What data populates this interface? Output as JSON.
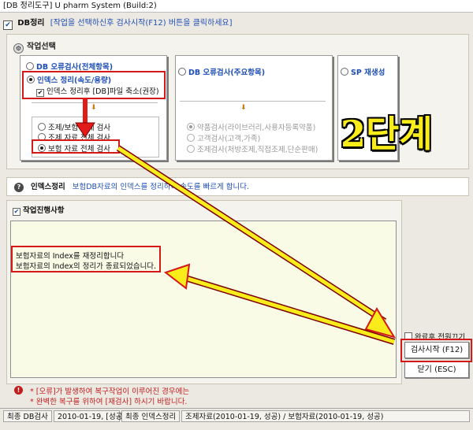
{
  "window": {
    "title": "[DB 정리도구] U pharm System (Build:2)"
  },
  "header": {
    "check": "✔",
    "title": "DB정리",
    "hint": "[작업을 선택하신후 검사시작(F12) 버튼을 클릭하세요]"
  },
  "task_select": {
    "title": "작업선택",
    "group1": {
      "title": "DB 오류검사(전체항목)",
      "options": [
        {
          "label": "인덱스 정리(속도/용량)"
        },
        {
          "label": "인덱스 정리후 [DB]파일 축소(권장)"
        }
      ],
      "scope_options": [
        {
          "label": "조제/보험 전체 검사"
        },
        {
          "label": "조제 자료 전체 검사"
        },
        {
          "label": "보험 자료 전체 검사"
        }
      ]
    },
    "group2": {
      "title": "DB 오류검사(주요항목)",
      "options": [
        {
          "label": "약품검사(라이브러리,사용자등록약품)"
        },
        {
          "label": "고객검사(고객,가족)"
        },
        {
          "label": "조제검사(처방조제,직접조제,단순판매)"
        }
      ]
    },
    "group3": {
      "title": "SP 재생성"
    }
  },
  "info": {
    "icon": "?",
    "title": "인덱스정리",
    "text": "보험DB자료의 인덱스를 정리하여 속도를 빠르게 합니다."
  },
  "progress": {
    "title": "작업진행사항",
    "log": [
      "보험자료의 Index를 재정리합니다",
      "보험자료의 Index의 정리가 종료되었습니다."
    ]
  },
  "actions": {
    "shutdown_label": "완료후 전원끄기",
    "start_label": "검사시작 (F12)",
    "close_label": "닫기 (ESC)"
  },
  "warning": {
    "icon": "!",
    "lines": [
      "* [오류]가 발생하여 복구작업이 이루어진 경우에는",
      "* 완벽한 복구를 위하여 [재검사] 하시기 바랍니다."
    ]
  },
  "status_bar": {
    "last_db_check_label": "최종 DB검사",
    "last_db_check_value": "2010-01-19, [성공]",
    "last_index_label": "최종 인덱스정리",
    "last_index_value": "조제자료(2010-01-19, 성공) / 보험자료(2010-01-19, 성공)"
  },
  "annotation": {
    "step_label": "2단계"
  },
  "colors": {
    "accent_blue": "#1f4fb5",
    "annotation_red": "#d51818",
    "annotation_yellow": "#f8ec1a",
    "log_bg": "#f9fbe6"
  }
}
